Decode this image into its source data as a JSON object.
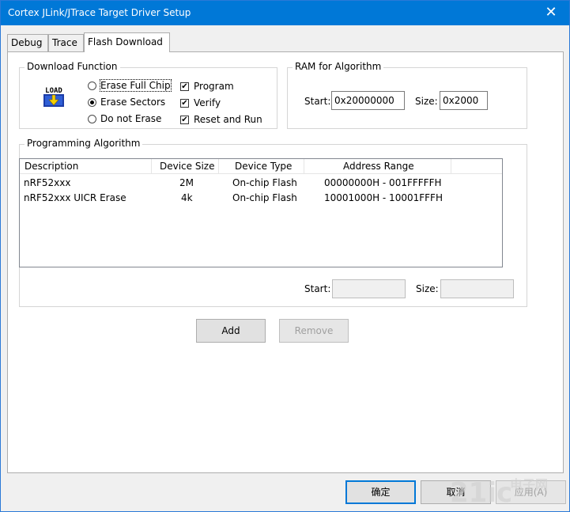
{
  "window": {
    "title": "Cortex JLink/JTrace Target Driver Setup",
    "close_symbol": "✕"
  },
  "tabs": [
    {
      "label": "Debug"
    },
    {
      "label": "Trace"
    },
    {
      "label": "Flash Download",
      "active": true
    }
  ],
  "download_function": {
    "group_label": "Download Function",
    "icon_label": "LOAD",
    "radios": [
      {
        "label": "Erase Full Chip",
        "checked": false
      },
      {
        "label": "Erase Sectors",
        "checked": true
      },
      {
        "label": "Do not Erase",
        "checked": false
      }
    ],
    "checkboxes": [
      {
        "label": "Program",
        "checked": true,
        "mark": "✔"
      },
      {
        "label": "Verify",
        "checked": true,
        "mark": "✔"
      },
      {
        "label": "Reset and Run",
        "checked": true,
        "mark": "✔"
      }
    ]
  },
  "ram": {
    "group_label": "RAM for Algorithm",
    "start_label": "Start:",
    "start_value": "0x20000000",
    "size_label": "Size:",
    "size_value": "0x2000"
  },
  "programming_algorithm": {
    "group_label": "Programming Algorithm",
    "columns": [
      "Description",
      "Device Size",
      "Device Type",
      "Address Range"
    ],
    "rows": [
      {
        "description": "nRF52xxx",
        "size": "2M",
        "type": "On-chip Flash",
        "range": "00000000H - 001FFFFFH"
      },
      {
        "description": "nRF52xxx UICR Erase",
        "size": "4k",
        "type": "On-chip Flash",
        "range": "10001000H - 10001FFFH"
      }
    ],
    "start_label": "Start:",
    "start_value": "",
    "size_label": "Size:",
    "size_value": ""
  },
  "buttons": {
    "add": "Add",
    "remove": "Remove",
    "ok": "确定",
    "cancel": "取消",
    "apply": "应用(A)"
  },
  "watermark": {
    "text": "21ic",
    "subtext": "电子网"
  },
  "colors": {
    "titlebar": "#0078d7",
    "dialog_bg": "#f0f0f0",
    "panel_bg": "#ffffff",
    "watermark": "#d6d6d6"
  }
}
